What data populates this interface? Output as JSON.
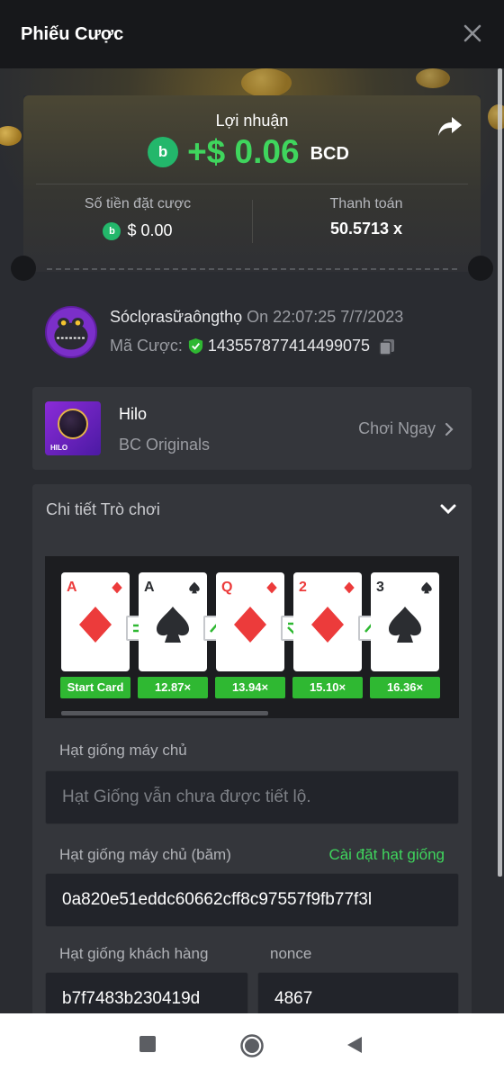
{
  "header": {
    "title": "Phiếu Cược"
  },
  "summary": {
    "profit_label": "Lợi nhuận",
    "profit_amount": "+$ 0.06",
    "profit_currency": "BCD",
    "bet_amount_label": "Số tiền đặt cược",
    "bet_amount_value": "$ 0.00",
    "payout_label": "Thanh toán",
    "payout_value": "50.5713 x",
    "coin_icon": "bc-coin-icon"
  },
  "user": {
    "name": "Sóclọrasữaôngthọ",
    "on_text": "On 22:07:25 7/7/2023",
    "bet_id_label": "Mã Cược:",
    "bet_id_value": "143557877414499075"
  },
  "game": {
    "name": "Hilo",
    "provider": "BC Originals",
    "play_label": "Chơi Ngay",
    "thumb_text": "HILO"
  },
  "details": {
    "title": "Chi tiết Trò chơi",
    "cards": [
      {
        "rank": "A",
        "suit": "diamond",
        "color": "red",
        "multiplier": "Start Card"
      },
      {
        "rank": "A",
        "suit": "spade",
        "color": "dark",
        "multiplier": "12.87×"
      },
      {
        "rank": "Q",
        "suit": "diamond",
        "color": "red",
        "multiplier": "13.94×"
      },
      {
        "rank": "2",
        "suit": "diamond",
        "color": "red",
        "multiplier": "15.10×"
      },
      {
        "rank": "3",
        "suit": "spade",
        "color": "dark",
        "multiplier": "16.36×"
      }
    ],
    "guesses": [
      "equal",
      "higher",
      "lower",
      "higher"
    ],
    "server_seed_label": "Hạt giống máy chủ",
    "server_seed_placeholder": "Hạt Giống vẫn chưa được tiết lộ.",
    "server_seed_hash_label": "Hạt giống máy chủ (băm)",
    "set_seed_link": "Cài đặt hạt giống",
    "server_seed_hash_value": "0a820e51eddc60662cff8c97557f9fb77f3l",
    "client_seed_label": "Hạt giống khách hàng",
    "client_seed_value": "b7f7483b230419d",
    "nonce_label": "nonce",
    "nonce_value": "4867"
  },
  "colors": {
    "profit_green": "#3fd55d",
    "multiplier_green": "#2fb832",
    "card_red": "#ec3b3b"
  }
}
